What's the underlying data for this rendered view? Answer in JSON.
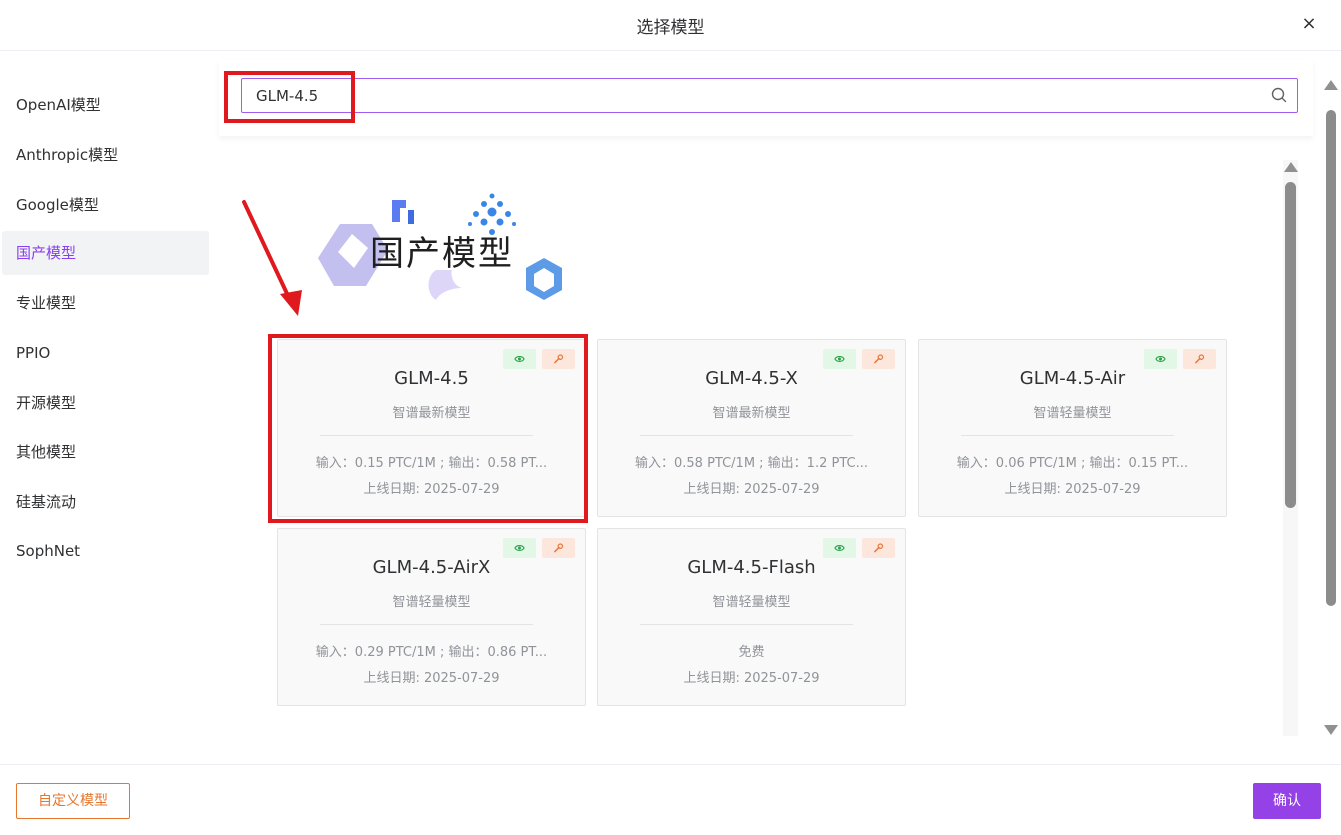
{
  "dialog": {
    "title": "选择模型",
    "close_symbol": "×"
  },
  "search": {
    "value": "GLM-4.5",
    "placeholder": ""
  },
  "sidebar": {
    "items": [
      {
        "label": "OpenAI模型",
        "active": false
      },
      {
        "label": "Anthropic模型",
        "active": false
      },
      {
        "label": "Google模型",
        "active": false
      },
      {
        "label": "国产模型",
        "active": true
      },
      {
        "label": "专业模型",
        "active": false
      },
      {
        "label": "PPIO",
        "active": false
      },
      {
        "label": "开源模型",
        "active": false
      },
      {
        "label": "其他模型",
        "active": false
      },
      {
        "label": "硅基流动",
        "active": false
      },
      {
        "label": "SophNet",
        "active": false
      }
    ]
  },
  "banner": {
    "text": "国产模型"
  },
  "models": [
    {
      "name": "GLM-4.5",
      "desc": "智谱最新模型",
      "price": "输入：0.15 PTC/1M ; 输出：0.58 PT...",
      "date": "上线日期: 2025-07-29"
    },
    {
      "name": "GLM-4.5-X",
      "desc": "智谱最新模型",
      "price": "输入：0.58 PTC/1M ; 输出：1.2 PTC...",
      "date": "上线日期: 2025-07-29"
    },
    {
      "name": "GLM-4.5-Air",
      "desc": "智谱轻量模型",
      "price": "输入：0.06 PTC/1M ; 输出：0.15 PT...",
      "date": "上线日期: 2025-07-29"
    },
    {
      "name": "GLM-4.5-AirX",
      "desc": "智谱轻量模型",
      "price": "输入：0.29 PTC/1M ; 输出：0.86 PT...",
      "date": "上线日期: 2025-07-29"
    },
    {
      "name": "GLM-4.5-Flash",
      "desc": "智谱轻量模型",
      "price": "免费",
      "date": "上线日期: 2025-07-29"
    }
  ],
  "footer": {
    "custom_label": "自定义模型",
    "confirm_label": "确认"
  },
  "colors": {
    "accent": "#9442e8",
    "active_text": "#8a3ff0",
    "custom_button": "#e6772d",
    "annotation_red": "#e0191f",
    "eye_bg": "#e3f7e6",
    "key_bg": "#fde7dd"
  }
}
